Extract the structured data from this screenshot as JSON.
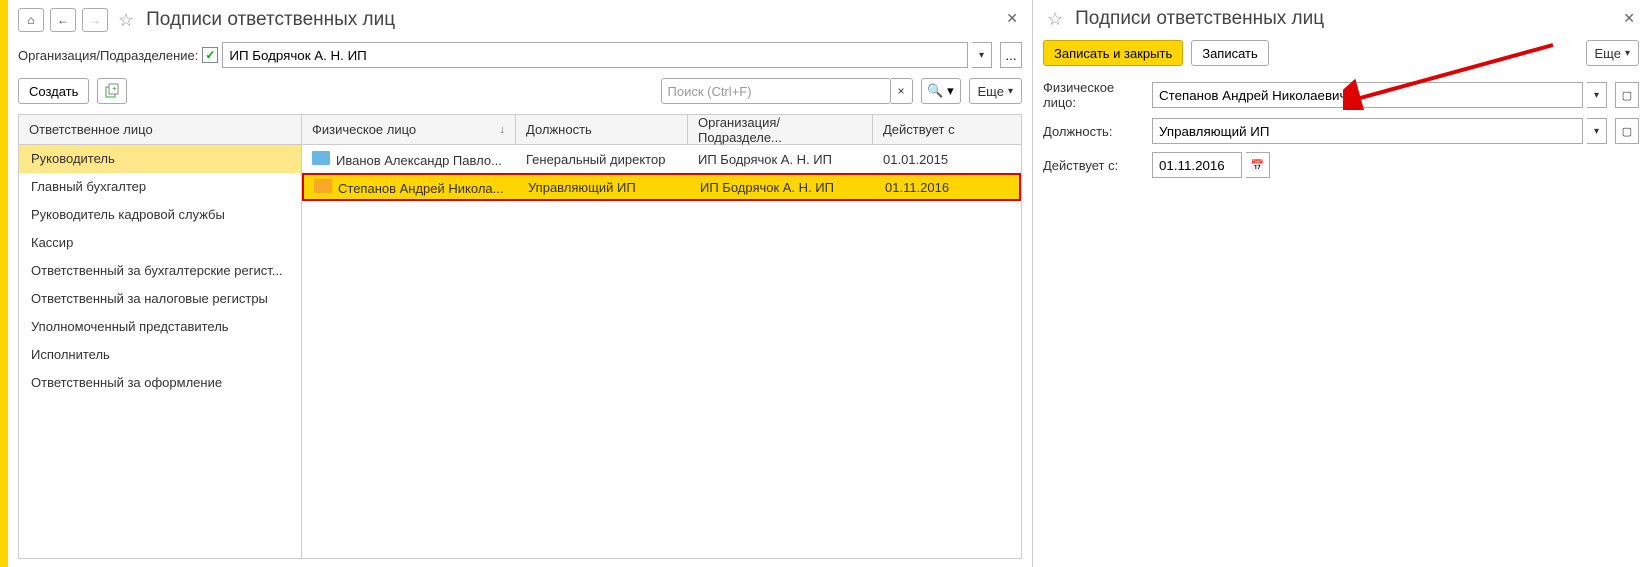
{
  "left": {
    "title": "Подписи ответственных лиц",
    "filter_label": "Организация/Подразделение:",
    "org_value": "ИП Бодрячок А. Н. ИП",
    "create_btn": "Создать",
    "search_placeholder": "Поиск (Ctrl+F)",
    "more_btn": "Еще",
    "list_header": "Ответственное лицо",
    "list_items": [
      "Руководитель",
      "Главный бухгалтер",
      "Руководитель кадровой службы",
      "Кассир",
      "Ответственный за бухгалтерские регист...",
      "Ответственный за налоговые регистры",
      "Уполномоченный представитель",
      "Исполнитель",
      "Ответственный за оформление"
    ],
    "table_headers": {
      "phys": "Физическое лицо",
      "pos": "Должность",
      "org": "Организация/Подразделе...",
      "date": "Действует с"
    },
    "rows": [
      {
        "phys": "Иванов Александр Павло...",
        "pos": "Генеральный директор",
        "org": "ИП Бодрячок А. Н. ИП",
        "date": "01.01.2015"
      },
      {
        "phys": "Степанов Андрей Никола...",
        "pos": "Управляющий ИП",
        "org": "ИП Бодрячок А. Н. ИП",
        "date": "01.11.2016"
      }
    ]
  },
  "right": {
    "title": "Подписи ответственных лиц",
    "save_close": "Записать и закрыть",
    "save": "Записать",
    "more": "Еще",
    "phys_label": "Физическое лицо:",
    "phys_value": "Степанов Андрей Николаевич",
    "pos_label": "Должность:",
    "pos_value": "Управляющий ИП",
    "date_label": "Действует с:",
    "date_value": "01.11.2016"
  }
}
